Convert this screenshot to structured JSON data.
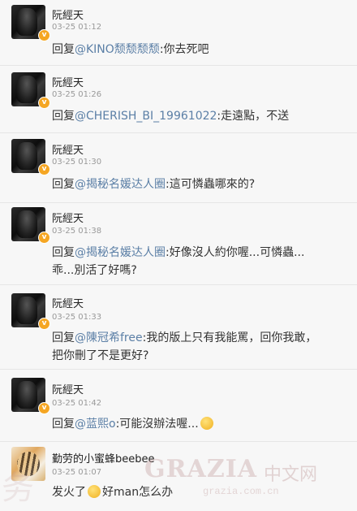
{
  "comments": [
    {
      "name": "阮經天",
      "time": "03-25 01:12",
      "verified": true,
      "avatar": "dark-portrait",
      "prefix": "回复",
      "mention": "@KINO颓颓颓颓",
      "text": ":你去死吧"
    },
    {
      "name": "阮經天",
      "time": "03-25 01:26",
      "verified": true,
      "avatar": "dark-portrait",
      "prefix": "回复",
      "mention": "@CHERISH_BI_19961022",
      "text": ":走遠點，不送"
    },
    {
      "name": "阮經天",
      "time": "03-25 01:30",
      "verified": true,
      "avatar": "dark-portrait",
      "prefix": "回复",
      "mention": "@揭秘名媛达人圈",
      "text": ":這可憐蟲哪來的?"
    },
    {
      "name": "阮經天",
      "time": "03-25 01:38",
      "verified": true,
      "avatar": "dark-portrait",
      "prefix": "回复",
      "mention": "@揭秘名媛达人圈",
      "text": ":好像沒人約你喔...可憐蟲...",
      "text2": "乖...別活了好嗎?"
    },
    {
      "name": "阮經天",
      "time": "03-25 01:33",
      "verified": true,
      "avatar": "dark-portrait",
      "prefix": "回复",
      "mention": "@陳冠希free",
      "text": ":我的版上只有我能罵，回你我敢，",
      "text2": "把你刪了不是更好?"
    },
    {
      "name": "阮經天",
      "time": "03-25 01:42",
      "verified": true,
      "avatar": "dark-portrait",
      "prefix": "回复",
      "mention": "@蓝熙o",
      "text": ":可能沒辦法喔...",
      "emoji": "sweat-emoji"
    },
    {
      "name": "勤劳的小蜜蜂beebee",
      "time": "03-25 01:07",
      "verified": false,
      "avatar": "tiger",
      "text": "发火了",
      "emoji": "angry-emoji",
      "text_after": "好man怎么办"
    }
  ],
  "watermark": {
    "brand": "GRAZIA",
    "cn": "中文网",
    "url": "grazia.com.cn"
  }
}
